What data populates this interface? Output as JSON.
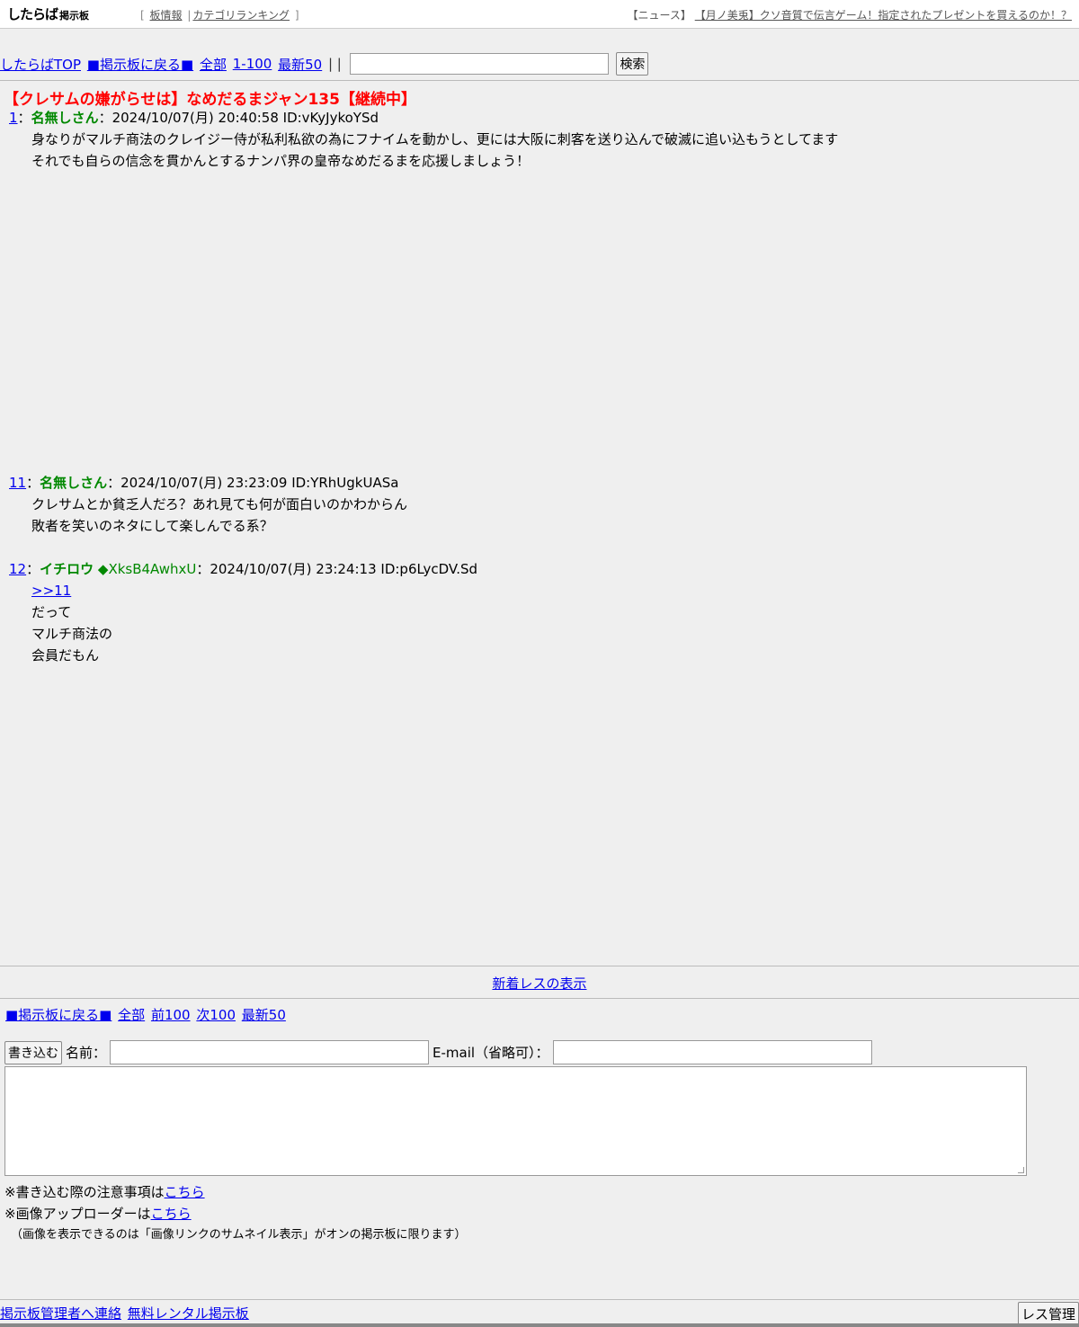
{
  "header": {
    "logo_main": "したらば",
    "logo_sub": "掲示板",
    "links": [
      {
        "label": "板情報"
      },
      {
        "label": "カテゴリランキング"
      }
    ],
    "bracket_open": "[",
    "bracket_close": "]",
    "pipe": "|",
    "news_prefix": "【ニュース】",
    "news_link": "【月ノ美兎】クソ音質で伝言ゲーム！指定されたプレゼントを買えるのか！？"
  },
  "nav": {
    "top": "したらばTOP",
    "back": "■掲示板に戻る■",
    "all": "全部",
    "range": "1-100",
    "latest": "最新50",
    "separator": "| |",
    "search_button": "検索"
  },
  "thread": {
    "title": "【クレサムの嫌がらせは】なめだるまジャン135【継続中】"
  },
  "posts": [
    {
      "num": "1",
      "sep": "：",
      "name": "名無しさん",
      "trip": "",
      "meta": "：2024/10/07(月) 20:40:58 ID:vKyJykoYSd",
      "lines": [
        "身なりがマルチ商法のクレイジー侍が私利私欲の為にフナイムを動かし、更には大阪に刺客を送り込んで破滅に追い込もうとしてます",
        "それでも自らの信念を貫かんとするナンパ界の皇帝なめだるまを応援しましょう！"
      ]
    },
    {
      "num": "11",
      "sep": "：",
      "name": "名無しさん",
      "trip": "",
      "meta": "：2024/10/07(月) 23:23:09 ID:YRhUgkUASa",
      "lines": [
        "クレサムとか貧乏人だろ？あれ見ても何が面白いのかわからん",
        "敗者を笑いのネタにして楽しんでる系？"
      ]
    },
    {
      "num": "12",
      "sep": "：",
      "name": "イチロウ",
      "trip": "◆XksB4AwhxU",
      "meta": "：2024/10/07(月) 23:24:13 ID:p6LycDV.Sd",
      "anchor": ">>11",
      "lines": [
        "だって",
        "マルチ商法の",
        "会員だもん"
      ]
    }
  ],
  "new_res": "新着レスの表示",
  "nav2": {
    "back": "■掲示板に戻る■",
    "all": "全部",
    "prev": "前100",
    "next": "次100",
    "latest": "最新50"
  },
  "form": {
    "submit": "書き込む",
    "name_label": "名前：",
    "email_label": "E-mail（省略可）：",
    "name_value": "",
    "email_value": "",
    "message_value": ""
  },
  "notes": {
    "caution_prefix": "※書き込む際の注意事項は",
    "caution_link": "こちら",
    "uploader_prefix": "※画像アップローダーは",
    "uploader_link": "こちら",
    "image_note": "（画像を表示できるのは「画像リンクのサムネイル表示」がオンの掲示板に限ります）"
  },
  "footer": {
    "contact": "掲示板管理者へ連絡",
    "rental": "無料レンタル掲示板",
    "res_manage": "レス管理"
  }
}
